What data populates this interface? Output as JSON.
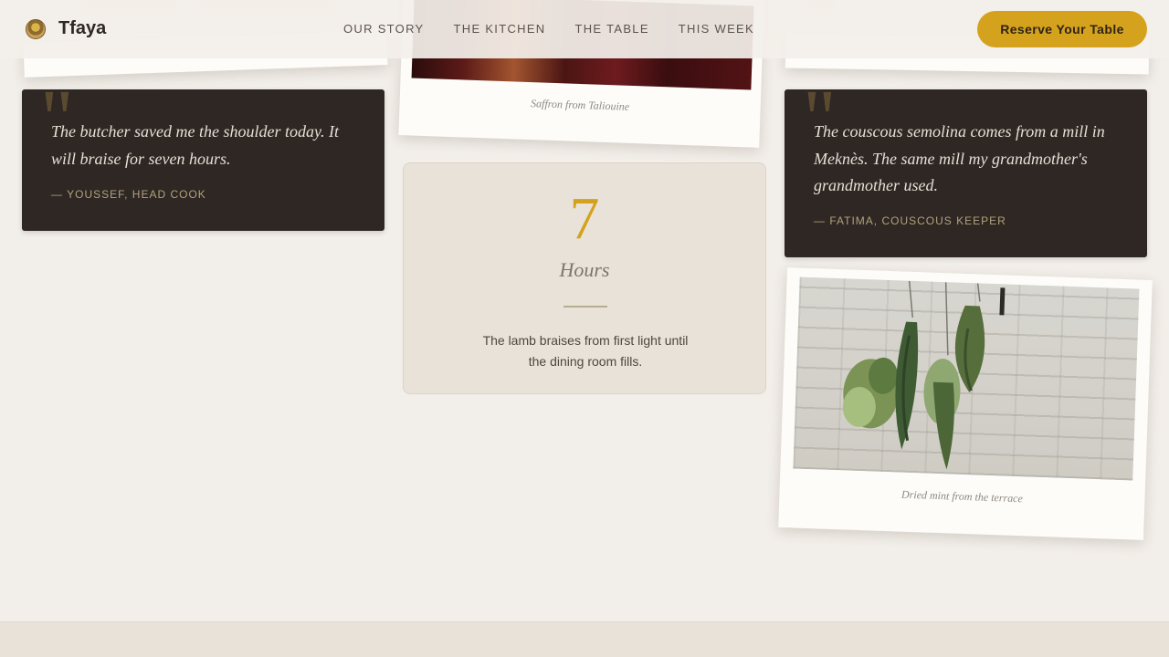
{
  "brand": {
    "name": "Tfaya",
    "logo_icon": "sunburst-emblem-icon"
  },
  "nav": {
    "items": [
      "OUR STORY",
      "THE KITCHEN",
      "THE TABLE",
      "THIS WEEK"
    ]
  },
  "cta": {
    "label": "Reserve Your Table"
  },
  "photos": {
    "saffron": {
      "caption": "Saffron from Taliouine"
    },
    "mint": {
      "caption": "Dried mint from the terrace"
    }
  },
  "quotes": [
    {
      "text": "The butcher saved me the shoulder today. It will braise for seven hours.",
      "author": "— YOUSSEF, HEAD COOK"
    },
    {
      "text": "The couscous semolina comes from a mill in Meknès. The same mill my grandmother's grandmother used.",
      "author": "— FATIMA, COUSCOUS KEEPER"
    }
  ],
  "stat": {
    "number": "7",
    "unit": "Hours",
    "description": "The lamb braises from first light until the dining room fills."
  },
  "colors": {
    "accent": "#d4a21c",
    "dark_card": "#2e2724",
    "background": "#f2eee9"
  }
}
